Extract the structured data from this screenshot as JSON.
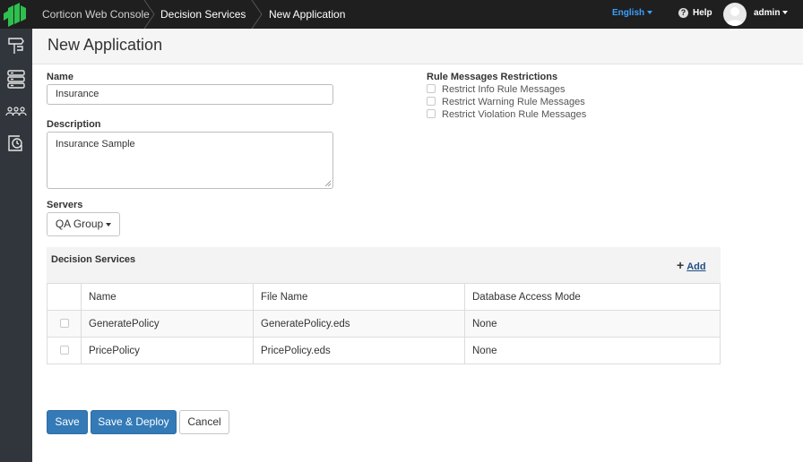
{
  "topbar": {
    "app_name": "Corticon Web Console",
    "breadcrumbs": [
      "Decision Services",
      "New Application"
    ],
    "language": "English",
    "help_label": "Help",
    "user": "admin"
  },
  "sidebar": {
    "items": [
      {
        "icon": "rule-signpost-icon"
      },
      {
        "icon": "server-stack-icon"
      },
      {
        "icon": "users-group-icon"
      },
      {
        "icon": "monitor-clock-icon"
      }
    ]
  },
  "page": {
    "title": "New Application"
  },
  "form": {
    "name_label": "Name",
    "name_value": "Insurance",
    "description_label": "Description",
    "description_value": "Insurance Sample",
    "servers_label": "Servers",
    "servers_selected": "QA Group"
  },
  "rule_messages": {
    "title": "Rule Messages Restrictions",
    "options": [
      {
        "label": "Restrict Info Rule Messages",
        "checked": false
      },
      {
        "label": "Restrict Warning Rule Messages",
        "checked": false
      },
      {
        "label": "Restrict Violation Rule Messages",
        "checked": false
      }
    ]
  },
  "decision_services": {
    "title": "Decision Services",
    "add_label": "Add",
    "columns": [
      "",
      "Name",
      "File Name",
      "Database Access Mode"
    ],
    "rows": [
      {
        "name": "GeneratePolicy",
        "file": "GeneratePolicy.eds",
        "mode": "None"
      },
      {
        "name": "PricePolicy",
        "file": "PricePolicy.eds",
        "mode": "None"
      }
    ]
  },
  "actions": {
    "save": "Save",
    "save_deploy": "Save & Deploy",
    "cancel": "Cancel"
  },
  "colors": {
    "topbar": "#1f1f1f",
    "sidebar": "#31363c",
    "logo_green": "#2fbf4f",
    "primary": "#337ab7",
    "language_link": "#3aa0ff"
  }
}
